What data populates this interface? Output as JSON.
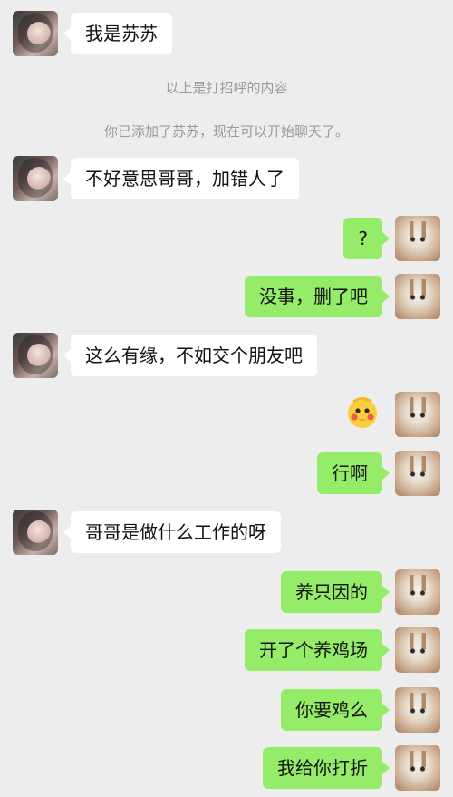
{
  "messages": [
    {
      "side": "left",
      "type": "text",
      "text": "我是苏苏"
    },
    {
      "side": "system",
      "type": "system",
      "text": "以上是打招呼的内容"
    },
    {
      "side": "system",
      "type": "system",
      "text": "你已添加了苏苏，现在可以开始聊天了。"
    },
    {
      "side": "left",
      "type": "text",
      "text": "不好意思哥哥，加错人了"
    },
    {
      "side": "right",
      "type": "text",
      "text": "?"
    },
    {
      "side": "right",
      "type": "text",
      "text": "没事，删了吧"
    },
    {
      "side": "left",
      "type": "text",
      "text": "这么有缘，不如交个朋友吧"
    },
    {
      "side": "right",
      "type": "sticker",
      "sticker": "yellow-duck-emoji"
    },
    {
      "side": "right",
      "type": "text",
      "text": "行啊"
    },
    {
      "side": "left",
      "type": "text",
      "text": "哥哥是做什么工作的呀"
    },
    {
      "side": "right",
      "type": "text",
      "text": "养只因的"
    },
    {
      "side": "right",
      "type": "text",
      "text": "开了个养鸡场"
    },
    {
      "side": "right",
      "type": "text",
      "text": "你要鸡么"
    },
    {
      "side": "right",
      "type": "text",
      "text": "我给你打折"
    }
  ],
  "colors": {
    "background": "#ededed",
    "incoming_bubble": "#ffffff",
    "outgoing_bubble": "#95ec69",
    "system_text": "#9b9b9b"
  }
}
